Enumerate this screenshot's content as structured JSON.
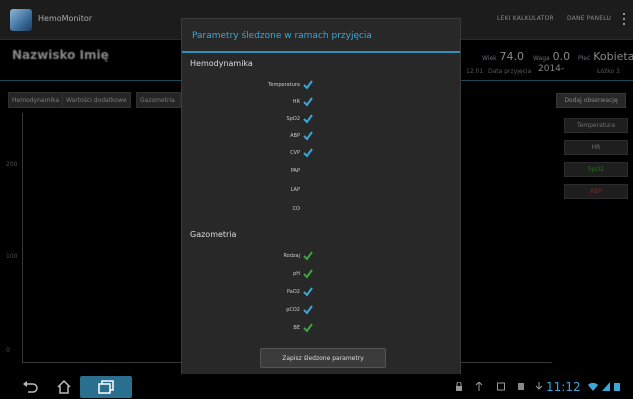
{
  "app": {
    "title": "HemoMonitor"
  },
  "actionbar": {
    "items": [
      "LEKI KALKULATOR",
      "DANE PANELU"
    ]
  },
  "patient": {
    "name": "Nazwisko Imię",
    "age_label": "Wiek",
    "age": "74.0",
    "weight_label": "Waga",
    "weight": "0.0",
    "sex_label": "Płeć",
    "sex": "Kobieta",
    "date_small": "12.01",
    "admission_label": "Data przyjęcia",
    "admission_date": "2014-",
    "extra": "Łóżko 3"
  },
  "tabs": [
    "Hemodynamika",
    "Wartości dodatkowe",
    "Gazometria"
  ],
  "add_button": "Dodaj obserwację",
  "side_params": [
    {
      "label": "Temperatura",
      "color": "#aaaaaa"
    },
    {
      "label": "HR",
      "color": "#aaaaaa"
    },
    {
      "label": "SpO2",
      "color": "#3aa53a"
    },
    {
      "label": "ABP",
      "color": "#c23a3a"
    }
  ],
  "chart_ticks": [
    "200",
    "100",
    "0"
  ],
  "dialog": {
    "title": "Parametry śledzone w ramach przyjęcia",
    "sections": [
      {
        "name": "Hemodynamika",
        "rows": [
          {
            "label": "Temperatura",
            "checked": true
          },
          {
            "label": "HR",
            "checked": true
          },
          {
            "label": "SpO2",
            "checked": true
          },
          {
            "label": "ABP",
            "checked": true
          },
          {
            "label": "CVP",
            "checked": true
          },
          {
            "label": "PAP",
            "checked": false
          },
          {
            "label": "LAP",
            "checked": false
          },
          {
            "label": "CO",
            "checked": false
          }
        ]
      },
      {
        "name": "Gazometria",
        "rows": [
          {
            "label": "Rodzaj",
            "checked": true
          },
          {
            "label": "pH",
            "checked": true
          },
          {
            "label": "PaO2",
            "checked": true
          },
          {
            "label": "pCO2",
            "checked": true
          },
          {
            "label": "BE",
            "checked": true
          }
        ]
      }
    ],
    "save_label": "Zapisz śledzone parametry"
  },
  "statusbar": {
    "time": "11:12"
  }
}
